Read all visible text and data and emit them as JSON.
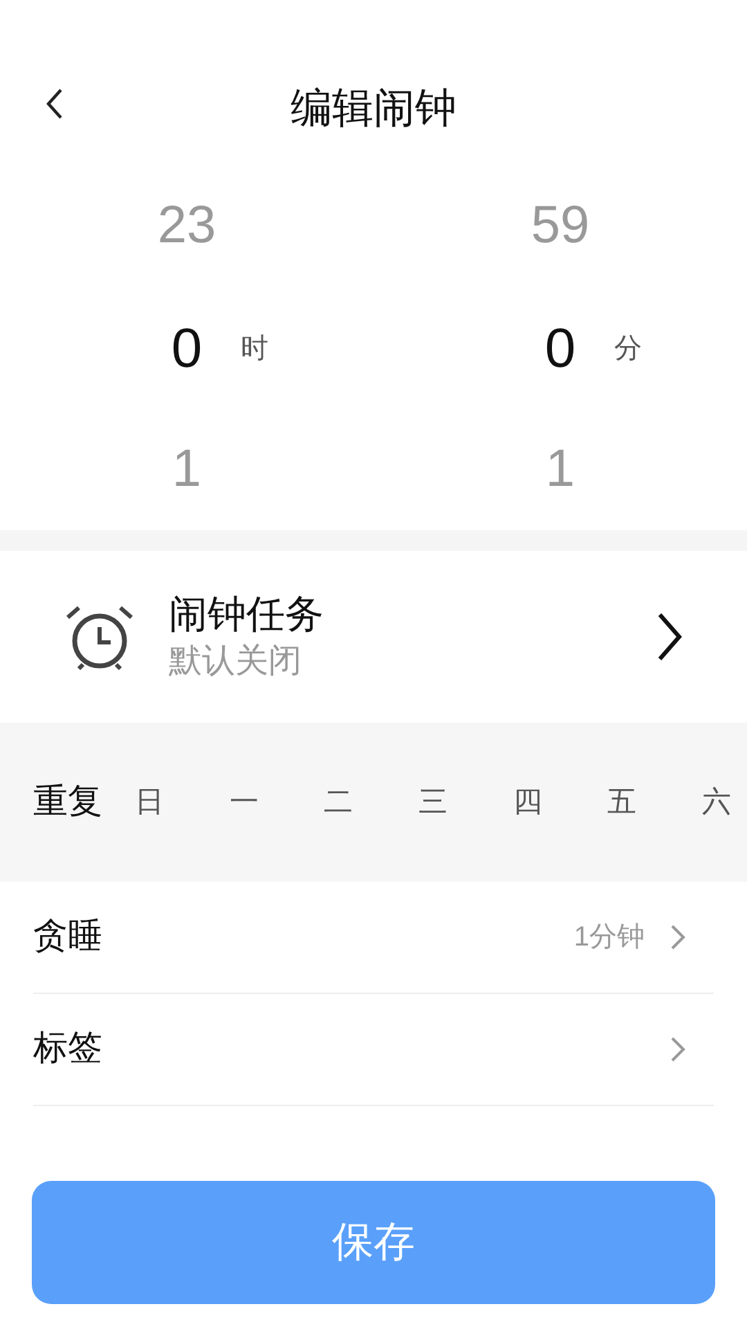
{
  "header": {
    "title": "编辑闹钟"
  },
  "picker": {
    "columns": [
      {
        "above": "23",
        "value": "0",
        "unit": "时",
        "below": "1"
      },
      {
        "above": "59",
        "value": "0",
        "unit": "分",
        "below": "1"
      }
    ]
  },
  "task": {
    "title": "闹钟任务",
    "subtitle": "默认关闭"
  },
  "repeat": {
    "label": "重复",
    "days": [
      "日",
      "一",
      "二",
      "三",
      "四",
      "五",
      "六"
    ]
  },
  "settings": [
    {
      "label": "贪睡",
      "value": "1分钟"
    },
    {
      "label": "标签"
    }
  ],
  "save_button": "保存"
}
